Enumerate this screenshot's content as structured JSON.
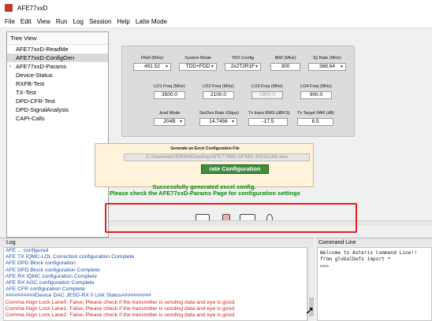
{
  "window": {
    "title": "AFE77xxD"
  },
  "menu": [
    "File",
    "Edit",
    "View",
    "Run",
    "Log",
    "Session",
    "Help",
    "Latte Mode"
  ],
  "tree": {
    "header": "Tree View",
    "items": [
      {
        "label": "AFE77xxD-ReadMe",
        "selected": false,
        "expandable": false
      },
      {
        "label": "AFE77xxD-ConfigGen",
        "selected": true,
        "expandable": false
      },
      {
        "label": "AFE77xxD-Params",
        "selected": false,
        "expandable": true
      },
      {
        "label": "Device-Status",
        "selected": false,
        "expandable": false
      },
      {
        "label": "RXFB-Test",
        "selected": false,
        "expandable": false
      },
      {
        "label": "TX-Test",
        "selected": false,
        "expandable": false
      },
      {
        "label": "DPD-CFR-Test",
        "selected": false,
        "expandable": false
      },
      {
        "label": "DPD-SignalAnalysis",
        "selected": false,
        "expandable": false
      },
      {
        "label": "CAPI-Calls",
        "selected": false,
        "expandable": false
      }
    ]
  },
  "config": {
    "row1": [
      {
        "label": "FRef (MHz)",
        "value": "491.52",
        "dropdown": true
      },
      {
        "label": "System Mode",
        "value": "TDD+FDD",
        "dropdown": true
      },
      {
        "label": "TRX Config",
        "value": "2x2T2R1F",
        "dropdown": true
      },
      {
        "label": "IBW (MHz)",
        "value": "300",
        "dropdown": false
      },
      {
        "label": "IQ Rate (MHz)",
        "value": "368.64",
        "dropdown": true
      }
    ],
    "row2": [
      {
        "label": "LO1 Freq (MHz)",
        "value": "3500.0",
        "disabled": false
      },
      {
        "label": "LO2 Freq (MHz)",
        "value": "2100.0",
        "disabled": false
      },
      {
        "label": "LO3 Freq (MHz)",
        "value": "1900.0",
        "disabled": true
      },
      {
        "label": "LO4 Freq (MHz)",
        "value": "900.0",
        "disabled": false
      }
    ],
    "row3": [
      {
        "label": "Jesd Mode",
        "value": "204B",
        "dropdown": true
      },
      {
        "label": "SerDes Rate (Gbps)",
        "value": "14.7456",
        "dropdown": true
      },
      {
        "label": "Tx Input RMS (dBFS)",
        "value": "-17.5",
        "dropdown": false
      },
      {
        "label": "Tx Target PAR (dB)",
        "value": "8.5",
        "dropdown": false
      }
    ]
  },
  "generate": {
    "title": "Generate an Excel Configuration File",
    "path": "C:/Users/a0283094/Desktop/AFE7769D DFMO-20231109.xlsx",
    "button": "rate Configuration",
    "success_1": "Successfully generated excel config.",
    "success_2": "Please check the AFE77xxD-Params Page for configuration settings"
  },
  "log": {
    "header": "Log",
    "lines": [
      {
        "text": "AFE ... configured",
        "color": "#1f4fb5"
      },
      {
        "text": "AFE TX IQMC-LOL Correction configuration Complete",
        "color": "#1f4fb5"
      },
      {
        "text": "AFE DPD Block configuration",
        "color": "#1f4fb5"
      },
      {
        "text": "AFE DPD Block configuration Complete",
        "color": "#1f4fb5"
      },
      {
        "text": "AFE RX IQMC configuration Complete",
        "color": "#1f4fb5"
      },
      {
        "text": "AFE RX AGC configuration Complete",
        "color": "#1f4fb5"
      },
      {
        "text": "AFE CFR configuration Complete",
        "color": "#1f4fb5"
      },
      {
        "text": "##########Device DAC JESD-RX 0 Link Status##########",
        "color": "#1f4fb5"
      },
      {
        "text": "Comma Align Lock Lane0: False; Please check if the transmitter is sending data and eye is good.",
        "color": "#d41f1f"
      },
      {
        "text": "Comma Align Lock Lane1: False; Please check if the transmitter is sending data and eye is good.",
        "color": "#d41f1f"
      },
      {
        "text": "Comma Align Lock Lane2: False; Please check if the transmitter is sending data and eye is good.",
        "color": "#d41f1f"
      }
    ]
  },
  "command": {
    "header": "Command Line",
    "lines": [
      "Welcome to Asterix Command Line!!",
      "from globalDefs import *",
      ">>>"
    ]
  },
  "colors": {
    "highlight": "#e02020",
    "success": "#0a8a0a",
    "button": "#3e8e3e"
  }
}
